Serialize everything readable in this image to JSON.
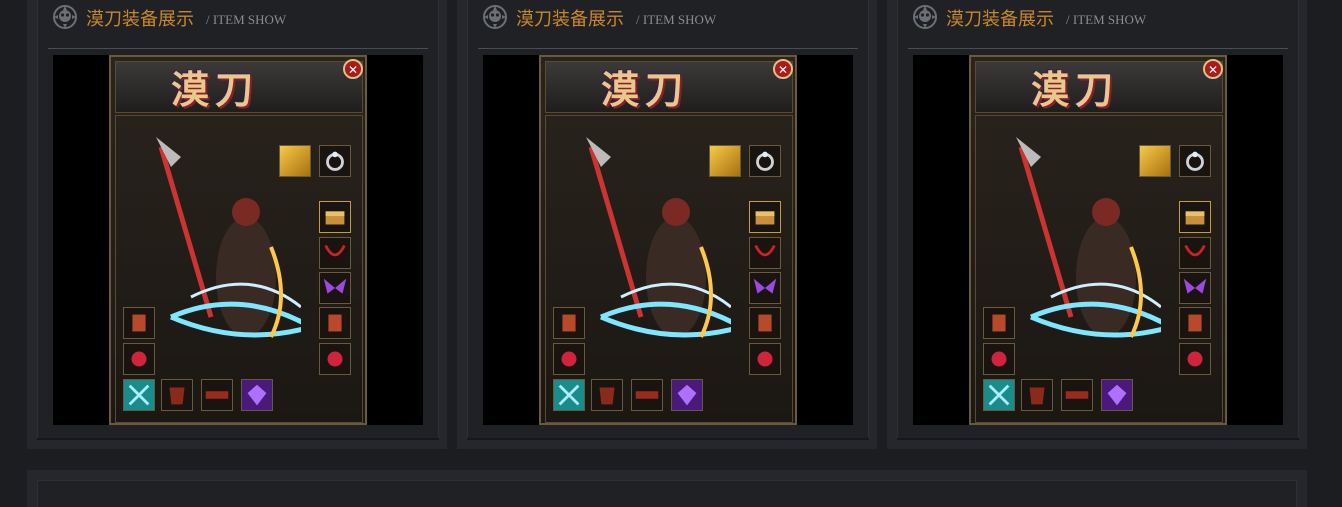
{
  "panels": [
    {
      "title": "漠刀装备展示",
      "subtitle": "/ ITEM SHOW",
      "logo_text": "漠刀",
      "close_glyph": "✕"
    },
    {
      "title": "漠刀装备展示",
      "subtitle": "/ ITEM SHOW",
      "logo_text": "漠刀",
      "close_glyph": "✕"
    },
    {
      "title": "漠刀装备展示",
      "subtitle": "/ ITEM SHOW",
      "logo_text": "漠刀",
      "close_glyph": "✕"
    }
  ],
  "icons": {
    "header": "skull-emblem-icon",
    "slots": [
      "medal-icon",
      "ring-icon",
      "treasure-chest-icon",
      "red-necklace-icon",
      "purple-wings-icon",
      "left-bracer-icon",
      "right-bracer-icon",
      "left-ring-icon",
      "right-ring-icon",
      "cyan-sword-icon",
      "armor-icon",
      "belt-icon",
      "purple-gem-icon"
    ]
  },
  "colors": {
    "title": "#c8872c",
    "subtitle": "#8a8c90",
    "background": "#1b1d21",
    "frame": "#6a5a3c"
  }
}
